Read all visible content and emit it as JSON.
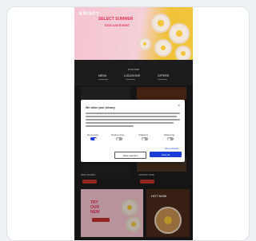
{
  "hero": {
    "logo": "KRISPY",
    "line1": "SELECT SUMMER",
    "line2": "DOZ-LIM EVENT"
  },
  "nav": {
    "subtitle": "EXPLORE",
    "items": [
      "MENU",
      "LOCATIONS",
      "OFFERS"
    ]
  },
  "tiles": {
    "caption_left": "NEW DOZEN",
    "caption_right": "LIMITED TIME"
  },
  "promo": {
    "left_lines": [
      "TRY",
      "OUR",
      "NEW"
    ],
    "right_label": "HOT NOW"
  },
  "cookie_dialog": {
    "title": "We value your privacy",
    "toggles": [
      "Necessary",
      "Preferences",
      "Statistics",
      "Marketing"
    ],
    "toggle_states": [
      true,
      false,
      false,
      false
    ],
    "details_link": "Show details",
    "decline_label": "Allow selection",
    "accept_label": "Allow all"
  },
  "colors": {
    "accent_blue": "#1a3ed6",
    "brand_pink": "#e4325a",
    "hero_yellow": "#f3c53a",
    "page_dark": "#1c1c1c"
  }
}
